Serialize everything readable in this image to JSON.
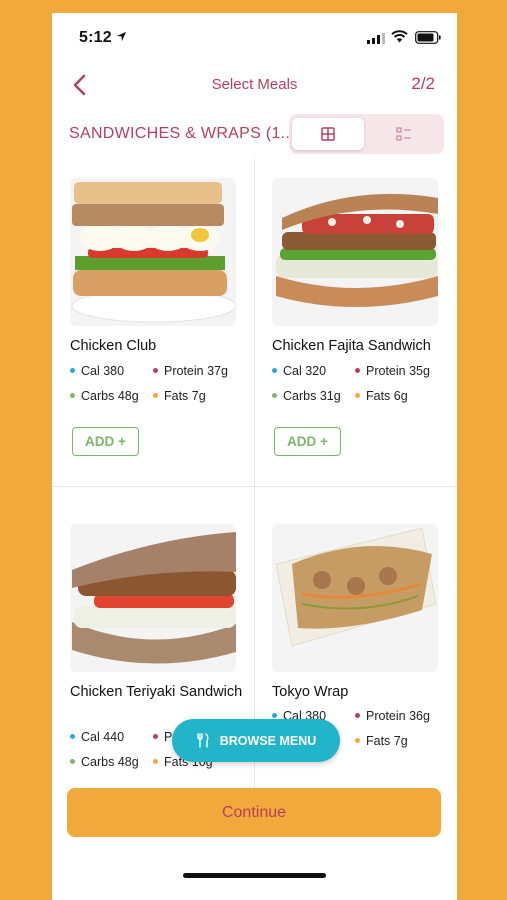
{
  "status": {
    "time": "5:12"
  },
  "nav": {
    "title": "Select Meals",
    "page": "2/2"
  },
  "category": {
    "title": "SANDWICHES & WRAPS (1..."
  },
  "meals": [
    {
      "name": "Chicken Club",
      "cal": "Cal 380",
      "protein": "Protein 37g",
      "carbs": "Carbs 48g",
      "fats": "Fats 7g",
      "add": "ADD +"
    },
    {
      "name": "Chicken Fajita Sandwich",
      "cal": "Cal 320",
      "protein": "Protein 35g",
      "carbs": "Carbs 31g",
      "fats": "Fats 6g",
      "add": "ADD +"
    },
    {
      "name": "Chicken Teriyaki Sandwich",
      "cal": "Cal 440",
      "protein": "Pr",
      "carbs": "Carbs 48g",
      "fats": "Fats 10g"
    },
    {
      "name": "Tokyo Wrap",
      "cal": "Cal 380",
      "protein": "Protein 36g",
      "carbs": "",
      "fats": "Fats 7g"
    }
  ],
  "browse_label": "BROWSE MENU",
  "continue_label": "Continue",
  "colors": {
    "cal": "#29A8D8",
    "protein": "#B5405B",
    "carbs": "#7DB56A",
    "fats": "#F2A93B",
    "accent": "#B5405B",
    "background": "#F2A93B"
  }
}
